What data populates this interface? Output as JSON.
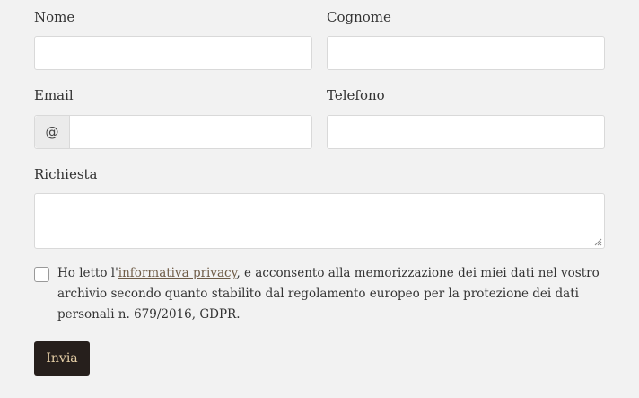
{
  "form": {
    "first_name": {
      "label": "Nome",
      "value": ""
    },
    "last_name": {
      "label": "Cognome",
      "value": ""
    },
    "email": {
      "label": "Email",
      "prefix": "@",
      "value": ""
    },
    "phone": {
      "label": "Telefono",
      "value": ""
    },
    "request": {
      "label": "Richiesta",
      "value": ""
    },
    "consent": {
      "checked": false,
      "text_before": "Ho letto l'",
      "link_text": "informativa privacy",
      "text_after": ", e acconsento alla memorizzazione dei miei dati nel vostro archivio secondo quanto stabilito dal regolamento europeo per la protezione dei dati personali n. 679/2016, GDPR."
    },
    "submit_label": "Invia"
  },
  "colors": {
    "background": "#f2f2f2",
    "submit_bg": "#261f1c",
    "submit_text": "#e6cfa7",
    "link": "#6e5b46"
  }
}
